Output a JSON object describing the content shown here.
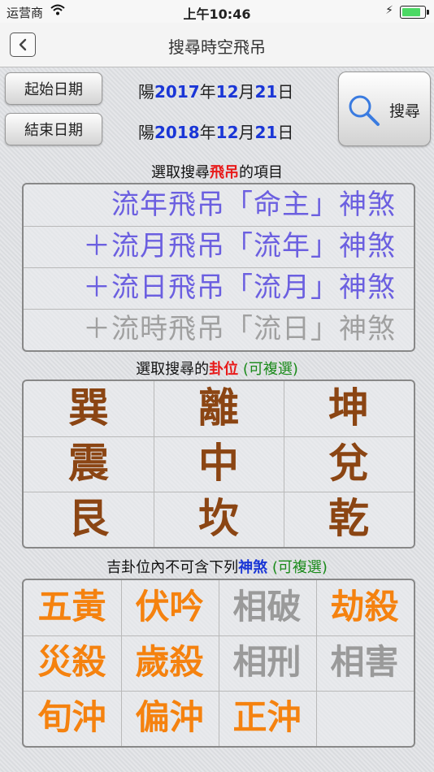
{
  "status_bar": {
    "carrier": "运营商",
    "time": "上午10:46",
    "battery_percent": 90
  },
  "nav": {
    "title": "搜尋時空飛吊",
    "back_icon": "chevron-left-icon"
  },
  "dates": {
    "start_label": "起始日期",
    "end_label": "結束日期",
    "start": {
      "prefix": "陽",
      "year": "2017",
      "y": "年",
      "month": "12",
      "m": "月",
      "day": "21",
      "d": "日"
    },
    "end": {
      "prefix": "陽",
      "year": "2018",
      "y": "年",
      "month": "12",
      "m": "月",
      "day": "21",
      "d": "日"
    }
  },
  "search": {
    "label": "搜尋",
    "icon": "magnifier-icon"
  },
  "fly_section": {
    "pre": "選取搜尋",
    "highlight": "飛吊",
    "post": "的項目"
  },
  "fly_items": [
    {
      "label": "流年飛吊「命主」神煞",
      "color": "#6b5fe0"
    },
    {
      "label": "＋流月飛吊「流年」神煞",
      "color": "#6b5fe0"
    },
    {
      "label": "＋流日飛吊「流月」神煞",
      "color": "#6b5fe0"
    },
    {
      "label": "＋流時飛吊「流日」神煞",
      "color": "#a0a0a0"
    }
  ],
  "gua_section": {
    "pre": "選取搜尋的",
    "highlight": "卦位",
    "post": " (可複選)"
  },
  "gua": [
    "巽",
    "離",
    "坤",
    "震",
    "中",
    "兌",
    "艮",
    "坎",
    "乾"
  ],
  "sha_section": {
    "pre": "吉卦位內不可含下列",
    "highlight": "神煞",
    "post": " (可複選)"
  },
  "sha": [
    {
      "label": "五黃",
      "color": "#f5820f"
    },
    {
      "label": "伏吟",
      "color": "#f5820f"
    },
    {
      "label": "相破",
      "color": "#9a9a9a"
    },
    {
      "label": "劫殺",
      "color": "#f5820f"
    },
    {
      "label": "災殺",
      "color": "#f5820f"
    },
    {
      "label": "歲殺",
      "color": "#f5820f"
    },
    {
      "label": "相刑",
      "color": "#9a9a9a"
    },
    {
      "label": "相害",
      "color": "#9a9a9a"
    },
    {
      "label": "旬沖",
      "color": "#f5820f"
    },
    {
      "label": "偏沖",
      "color": "#f5820f"
    },
    {
      "label": "正沖",
      "color": "#f5820f"
    },
    {
      "label": "",
      "color": "#9a9a9a"
    }
  ]
}
